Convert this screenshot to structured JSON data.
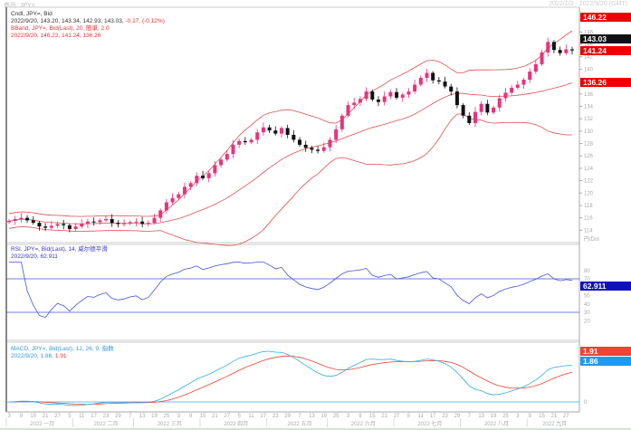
{
  "header": {
    "symbol": "商品: JPY=",
    "range": "2022/1/3 - 2022/9/20 (GMT)"
  },
  "main_legend": {
    "line1": "Cndl, JPY=, Bid",
    "line2": "2022/9/20, 143.20, 143.34, 142.93, 143.03,",
    "change": "-0.17, (-0.12%)",
    "line3": "BBand, JPY=, Bid(Last), 20, 簡単, 2.0",
    "line4": "2022/9/20, 146.22, 141.24, 136.26"
  },
  "rsi_legend": {
    "line1": "RSI, JPY=, Bid(Last), 14, 威尔德平滑",
    "line2": "2022/9/20, 62.911"
  },
  "macd_legend": {
    "line1": "MACD, JPY=, Bid(Last), 12, 26, 9, 指数",
    "line2a": "2022/9/20, 1.86,",
    "line2b": "1.91"
  },
  "price_boxes": {
    "upper": "146.22",
    "last": "143.03",
    "mid": "141.24",
    "lower": "136.26"
  },
  "rsi_box": "62.911",
  "macd_boxes": {
    "signal": "1.91",
    "macd": "1.86"
  },
  "axis_unit": "円/Dol",
  "colors": {
    "up": "#e8337e",
    "down": "#111111",
    "band": "#e05050",
    "rsi": "#4455dd",
    "macd": "#33aaee",
    "signal": "#ee4433"
  },
  "chart_data": {
    "type": "candlestick",
    "title": "JPY= Bid",
    "ylim": [
      112,
      150
    ],
    "yticks": [
      114,
      116,
      118,
      120,
      122,
      124,
      126,
      128,
      130,
      132,
      134,
      136,
      138,
      140,
      142,
      144,
      146,
      148
    ],
    "months": [
      "2022 一月",
      "2022 二月",
      "2022 三月",
      "2022 四月",
      "2022 五月",
      "2022 六月",
      "2022 七月",
      "2022 八月",
      "2022 九月"
    ],
    "month_starts": [
      0,
      11,
      21,
      32,
      43,
      53,
      64,
      75,
      86
    ],
    "close": [
      115.5,
      115.8,
      116.0,
      115.6,
      115.2,
      114.6,
      114.4,
      114.7,
      115.0,
      114.8,
      114.2,
      114.6,
      115.0,
      115.4,
      115.3,
      115.6,
      115.8,
      115.2,
      115.0,
      115.1,
      115.3,
      115.4,
      115.0,
      115.2,
      116.0,
      117.2,
      118.5,
      119.2,
      119.8,
      121.0,
      121.6,
      122.8,
      122.4,
      123.2,
      124.5,
      125.4,
      126.3,
      127.8,
      128.4,
      128.2,
      128.6,
      129.8,
      130.6,
      130.1,
      129.6,
      130.5,
      129.4,
      128.6,
      127.8,
      127.3,
      127.0,
      126.8,
      127.4,
      128.6,
      130.3,
      132.5,
      134.2,
      134.6,
      135.2,
      136.4,
      135.1,
      134.7,
      135.6,
      136.3,
      135.4,
      135.9,
      136.4,
      137.5,
      138.6,
      139.4,
      138.2,
      138.0,
      137.2,
      136.4,
      134.2,
      132.5,
      131.3,
      133.1,
      134.4,
      133.0,
      133.8,
      135.3,
      136.2,
      137.0,
      137.5,
      138.3,
      139.6,
      140.8,
      142.7,
      144.4,
      143.1,
      142.6,
      143.2,
      143.03
    ],
    "bbands": {
      "period": 20,
      "stdev": 2.0
    },
    "rsi": {
      "period": 14,
      "levels": [
        70,
        30
      ],
      "yticks": [
        80,
        70,
        60,
        50,
        40,
        30,
        20
      ],
      "last": 62.911
    },
    "macd": {
      "fast": 12,
      "slow": 26,
      "signal": 9,
      "last_macd": 1.86,
      "last_signal": 1.91
    }
  }
}
